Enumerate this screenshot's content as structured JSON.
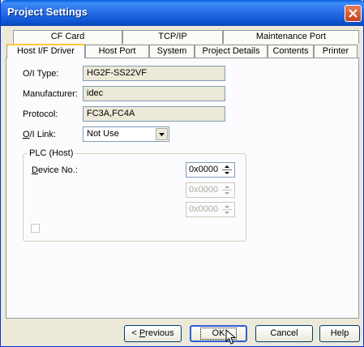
{
  "window": {
    "title": "Project Settings"
  },
  "tabs": {
    "row1": [
      "CF Card",
      "TCP/IP",
      "Maintenance Port"
    ],
    "row2": [
      "Host I/F Driver",
      "Host Port",
      "System",
      "Project Details",
      "Contents",
      "Printer"
    ],
    "active": "Host I/F Driver"
  },
  "form": {
    "oi_type_label": "O/I Type:",
    "oi_type_value": "HG2F-SS22VF",
    "manufacturer_label": "Manufacturer:",
    "manufacturer_value": "idec",
    "protocol_label": "Protocol:",
    "protocol_value": "FC3A,FC4A",
    "oi_link_label_prefix": "O",
    "oi_link_label_rest": "/I Link:",
    "oi_link_value": "Not Use"
  },
  "plc_group": {
    "label": "PLC (Host)",
    "device_label_prefix": "D",
    "device_label_rest": "evice No.:",
    "device_values": [
      "0x0000",
      "0x0000",
      "0x0000"
    ],
    "checkbox_checked": false
  },
  "buttons": {
    "previous_prefix": "< ",
    "previous_u": "P",
    "previous_rest": "revious",
    "ok": "OK",
    "cancel": "Cancel",
    "help": "Help"
  }
}
